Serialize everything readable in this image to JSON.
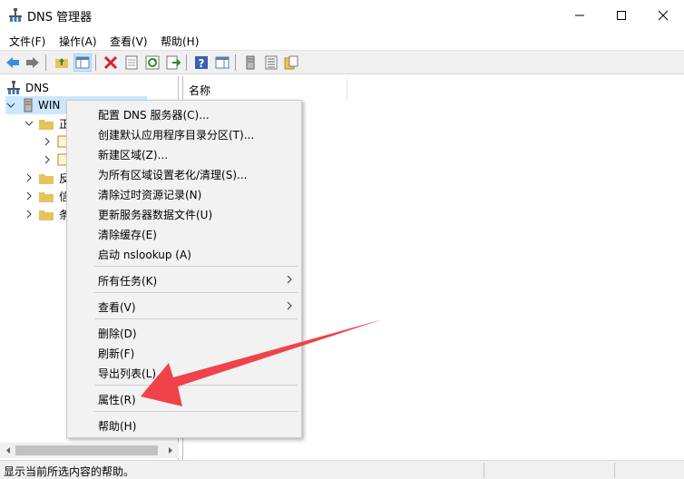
{
  "window": {
    "title": "DNS 管理器",
    "icon": "dns-app-icon"
  },
  "menubar": {
    "items": [
      "文件(F)",
      "操作(A)",
      "查看(V)",
      "帮助(H)"
    ]
  },
  "toolbar": {
    "icons": [
      "back-arrow-icon",
      "forward-arrow-icon",
      "up-folder-icon",
      "show-hide-console-tree-icon",
      "delete-icon",
      "properties-sheet-icon",
      "refresh-icon",
      "export-list-icon",
      "help-icon",
      "show-hide-action-pane-icon",
      "server-icon",
      "list-icon",
      "folder-properties-icon"
    ]
  },
  "tree": {
    "root": "DNS",
    "server": "WIN",
    "nodes": [
      "正",
      "",
      "",
      "反",
      "信",
      "条"
    ]
  },
  "content": {
    "column_name": "名称"
  },
  "context_menu": {
    "items": [
      "配置 DNS 服务器(C)...",
      "创建默认应用程序目录分区(T)...",
      "新建区域(Z)...",
      "为所有区域设置老化/清理(S)...",
      "清除过时资源记录(N)",
      "更新服务器数据文件(U)",
      "清除缓存(E)",
      "启动 nslookup (A)",
      "所有任务(K)",
      "查看(V)",
      "删除(D)",
      "刷新(F)",
      "导出列表(L)...",
      "属性(R)",
      "帮助(H)"
    ]
  },
  "statusbar": {
    "text": "显示当前所选内容的帮助。"
  },
  "colors": {
    "accent_arrow": "#f0424a",
    "selection": "#cce8ff",
    "folder": "#e8c25a"
  }
}
